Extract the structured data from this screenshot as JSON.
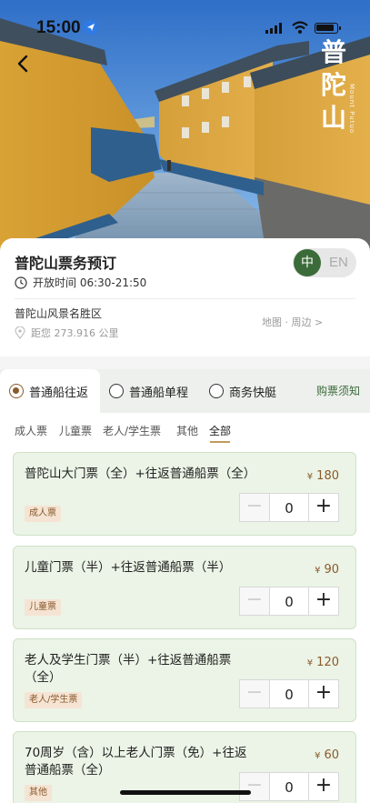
{
  "status": {
    "time": "15:00"
  },
  "hero": {
    "calligraphy": [
      "普",
      "陀",
      "山"
    ],
    "subtitle": "Mount Putuo"
  },
  "info": {
    "title": "普陀山票务预订",
    "hours": "开放时间 06:30-21:50",
    "place": "普陀山风景名胜区",
    "distance": "距您 273.916 公里",
    "map_link": "地图 · 周边 >",
    "lang_zh": "中",
    "lang_en": "EN"
  },
  "tabs": [
    {
      "label": "普通船往返",
      "selected": true
    },
    {
      "label": "普通船单程",
      "selected": false
    },
    {
      "label": "商务快艇",
      "selected": false
    }
  ],
  "notice": "购票须知",
  "filters": [
    "成人票",
    "儿童票",
    "老人/学生票",
    "其他",
    "全部"
  ],
  "active_filter": "全部",
  "currency": "¥",
  "tickets": [
    {
      "name": "普陀山大门票（全）+往返普通船票（全）",
      "price": "180",
      "badge": "成人票",
      "qty": "0"
    },
    {
      "name": "儿童门票（半）+往返普通船票（半）",
      "price": "90",
      "badge": "儿童票",
      "qty": "0"
    },
    {
      "name": "老人及学生门票（半）+往返普通船票（全）",
      "price": "120",
      "badge": "老人/学生票",
      "qty": "0"
    },
    {
      "name": "70周岁（含）以上老人门票（免）+往返普通船票（全）",
      "price": "60",
      "badge": "其他",
      "qty": "0"
    }
  ],
  "colors": {
    "brand_green": "#3c6b3a",
    "price_brown": "#8b5a2b",
    "card_green": "#ebf4e6"
  }
}
